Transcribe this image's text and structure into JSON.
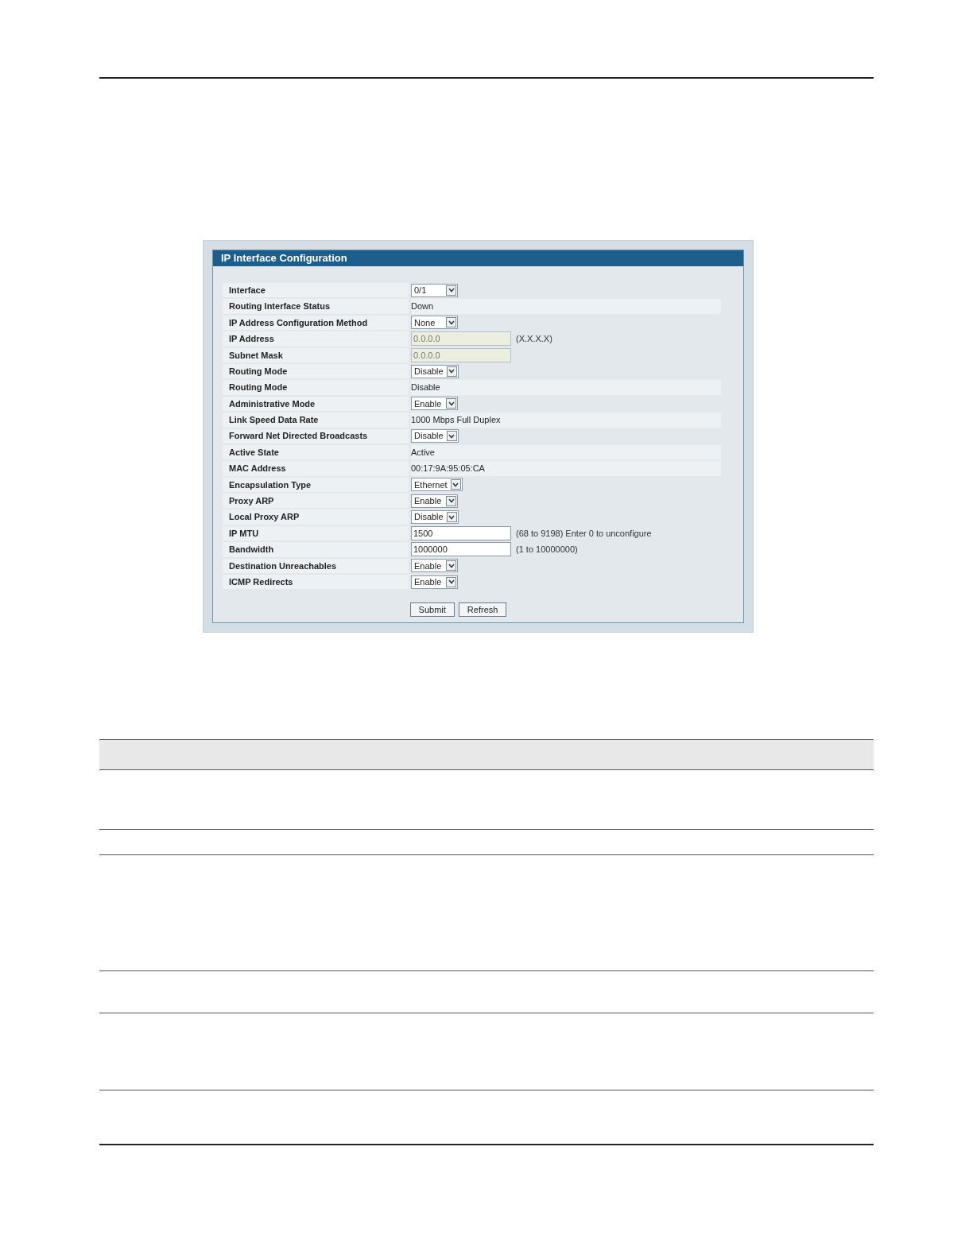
{
  "panel": {
    "title": "IP Interface Configuration",
    "rows": [
      {
        "label": "Interface",
        "kind": "select",
        "value": "0/1"
      },
      {
        "label": "Routing Interface Status",
        "kind": "text",
        "value": "Down"
      },
      {
        "label": "IP Address Configuration Method",
        "kind": "select",
        "value": "None"
      },
      {
        "label": "IP Address",
        "kind": "input",
        "value": "0.0.0.0",
        "disabled": true,
        "hint": "(X.X.X.X)"
      },
      {
        "label": "Subnet Mask",
        "kind": "input",
        "value": "0.0.0.0",
        "disabled": true
      },
      {
        "label": "Routing Mode",
        "kind": "select",
        "value": "Disable"
      },
      {
        "label": "Routing Mode",
        "kind": "text",
        "value": "Disable"
      },
      {
        "label": "Administrative Mode",
        "kind": "select",
        "value": "Enable"
      },
      {
        "label": "Link Speed Data Rate",
        "kind": "text",
        "value": "1000 Mbps Full Duplex"
      },
      {
        "label": "Forward Net Directed Broadcasts",
        "kind": "select",
        "value": "Disable"
      },
      {
        "label": "Active State",
        "kind": "text",
        "value": "Active"
      },
      {
        "label": "MAC Address",
        "kind": "text",
        "value": "00:17:9A:95:05:CA"
      },
      {
        "label": "Encapsulation Type",
        "kind": "select",
        "value": "Ethernet"
      },
      {
        "label": "Proxy ARP",
        "kind": "select",
        "value": "Enable"
      },
      {
        "label": "Local Proxy ARP",
        "kind": "select",
        "value": "Disable"
      },
      {
        "label": "IP MTU",
        "kind": "input",
        "value": "1500",
        "disabled": false,
        "hint": "(68 to 9198) Enter 0 to unconfigure"
      },
      {
        "label": "Bandwidth",
        "kind": "input",
        "value": "1000000",
        "disabled": false,
        "hint": "(1 to 10000000)"
      },
      {
        "label": "Destination Unreachables",
        "kind": "select",
        "value": "Enable"
      },
      {
        "label": "ICMP Redirects",
        "kind": "select",
        "value": "Enable"
      }
    ],
    "buttons": [
      "Submit",
      "Refresh"
    ]
  }
}
